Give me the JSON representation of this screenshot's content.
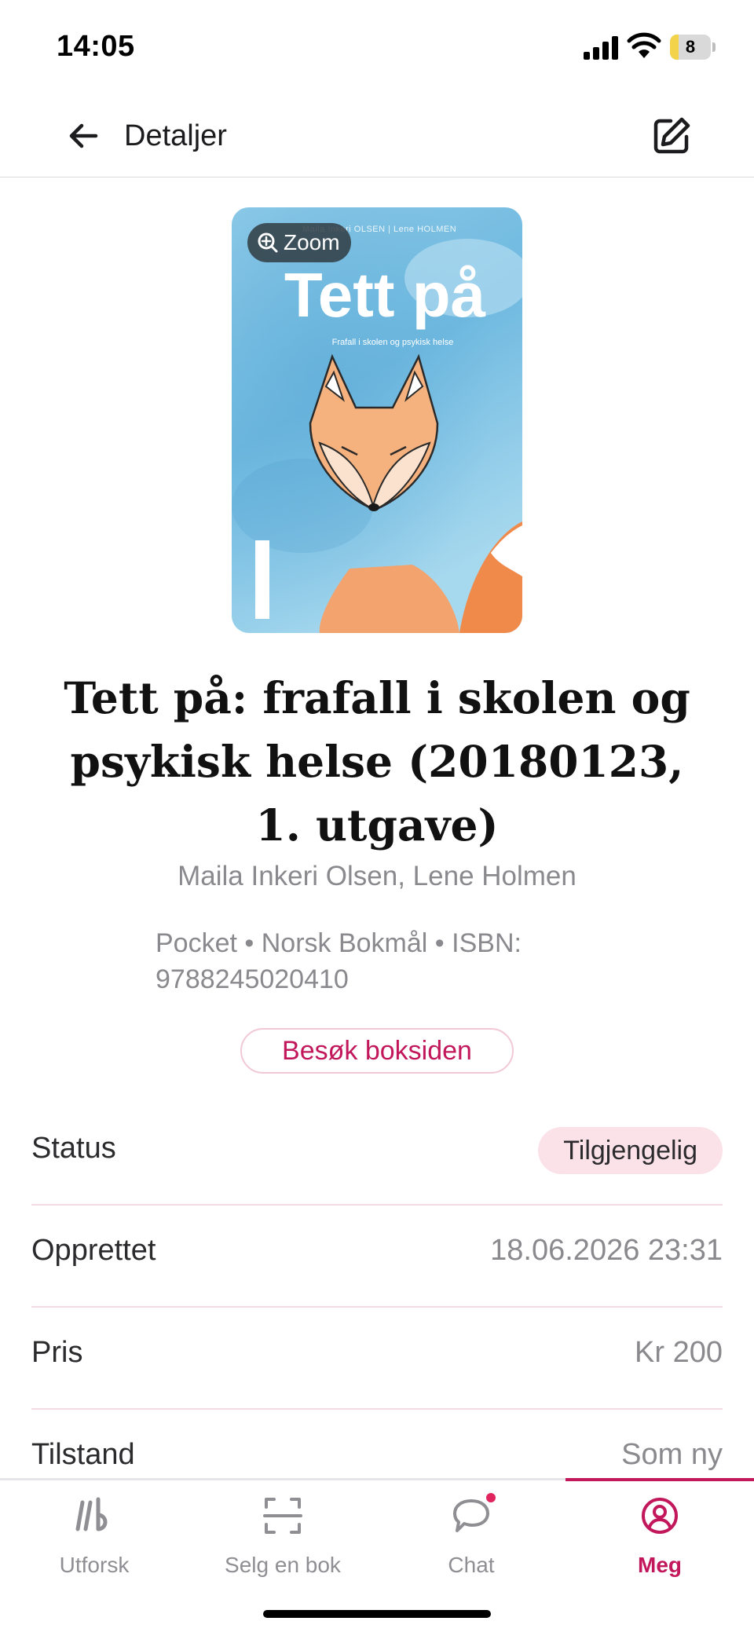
{
  "status_bar": {
    "time": "14:05",
    "battery_level": "8",
    "battery_fraction": 0.08
  },
  "header": {
    "title": "Detaljer",
    "back_icon": "arrow-left-icon",
    "edit_icon": "edit-icon"
  },
  "cover": {
    "zoom_label": "Zoom",
    "authors_text": "Maila Inkeri OLSEN | Lene HOLMEN",
    "title": "Tett på",
    "subtitle": "Frafall i skolen og psykisk helse"
  },
  "book": {
    "title": "Tett på: frafall i skolen og psykisk helse (20180123, 1. utgave)",
    "authors": "Maila Inkeri Olsen, Lene Holmen",
    "meta": "Pocket • Norsk Bokmål • ISBN: 9788245020410",
    "visit_button": "Besøk boksiden"
  },
  "details": [
    {
      "label": "Status",
      "value": "Tilgjengelig",
      "badge": true
    },
    {
      "label": "Opprettet",
      "value": "18.06.2026 23:31"
    },
    {
      "label": "Pris",
      "value": "Kr 200"
    },
    {
      "label": "Tilstand",
      "value": "Som ny"
    }
  ],
  "tabs": [
    {
      "label": "Utforsk",
      "icon": "lb-logo-icon"
    },
    {
      "label": "Selg en bok",
      "icon": "scan-icon"
    },
    {
      "label": "Chat",
      "icon": "chat-bubble-icon",
      "notification": true
    },
    {
      "label": "Meg",
      "icon": "user-circle-icon",
      "active": true
    }
  ],
  "colors": {
    "accent": "#c2185b",
    "badge_bg": "#fbe1e8",
    "muted": "#8a8a8e"
  }
}
